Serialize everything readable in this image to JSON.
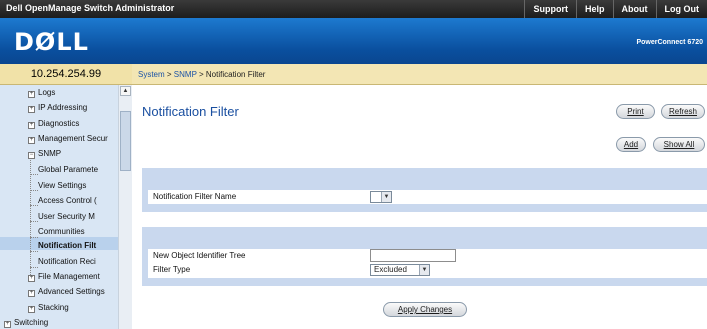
{
  "topbar": {
    "app_title": "Dell OpenManage Switch Administrator",
    "links": [
      "Support",
      "Help",
      "About",
      "Log Out"
    ]
  },
  "header": {
    "logo": "DØLL",
    "model": "PowerConnect 6720"
  },
  "sidebar": {
    "ip": "10.254.254.99",
    "items": {
      "logs": "Logs",
      "ip_addressing": "IP Addressing",
      "diagnostics": "Diagnostics",
      "management_security": "Management Secur",
      "snmp": "SNMP",
      "global_parameters": "Global Paramete",
      "view_settings": "View Settings",
      "access_control": "Access Control (",
      "user_security": "User Security M",
      "communities": "Communities",
      "notification_filter": "Notification Filt",
      "notification_recipients": "Notification Reci",
      "file_management": "File Management",
      "advanced_settings": "Advanced Settings",
      "stacking": "Stacking",
      "switching": "Switching"
    }
  },
  "breadcrumb": {
    "system": "System",
    "sep1": " > ",
    "snmp": "SNMP",
    "sep2": " > ",
    "current": "Notification Filter"
  },
  "main": {
    "title": "Notification Filter",
    "buttons": {
      "print": "Print",
      "refresh": "Refresh",
      "add": "Add",
      "show_all": "Show All",
      "apply": "Apply Changes"
    },
    "form": {
      "filter_name_label": "Notification Filter Name",
      "filter_name_value": "",
      "oid_tree_label": "New Object Identifier Tree",
      "oid_tree_value": "",
      "filter_type_label": "Filter Type",
      "filter_type_value": "Excluded"
    }
  }
}
